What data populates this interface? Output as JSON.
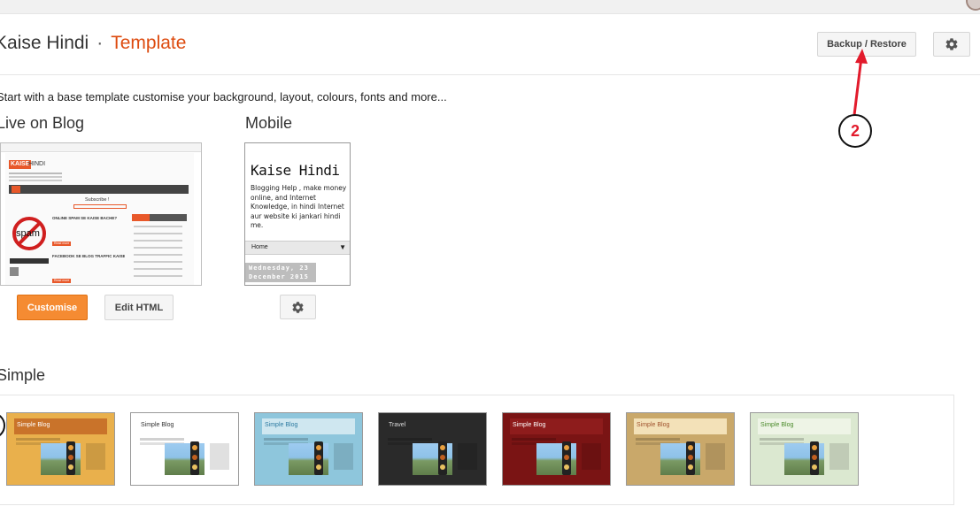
{
  "header": {
    "blog_name": "Kaise Hindi",
    "separator": "·",
    "section": "Template",
    "backup_restore_label": "Backup / Restore"
  },
  "intro_text": "Start with a base template customise your background, layout, colours, fonts and more...",
  "live": {
    "heading": "Live on Blog",
    "customise_label": "Customise",
    "edit_html_label": "Edit HTML",
    "preview": {
      "logo_badge": "KAISE",
      "logo_text": "HINDI",
      "subscribe": "Subscribe !",
      "spam": "spam",
      "post_title_1": "ONLINE SPAM SE KAISE BACHE?",
      "post_title_2": "FACEBOOK SE BLOG TRAFFIC KAISE PAAYE ...",
      "read_more": "Read more"
    }
  },
  "mobile": {
    "heading": "Mobile",
    "title": "Kaise Hindi",
    "description": "Blogging Help , make money online, and Internet Knowledge, in hindi Internet aur website ki jankari hindi me.",
    "home_label": "Home",
    "date_label": "Wednesday, 23 December 2015"
  },
  "simple": {
    "heading": "Simple",
    "themes": [
      {
        "label": "Simple Blog",
        "bg": "#e9b04c",
        "bar": "#c9732a",
        "panel": "#fff7e6",
        "text": "#ffffff"
      },
      {
        "label": "Simple Blog",
        "bg": "#ffffff",
        "bar": "#ffffff",
        "panel": "#ffffff",
        "text": "#333333"
      },
      {
        "label": "Simple Blog",
        "bg": "#8ec6dc",
        "bar": "#cfe7f0",
        "panel": "#ffffff",
        "text": "#2c7aa0"
      },
      {
        "label": "Travel",
        "bg": "#2a2a2a",
        "bar": "#2a2a2a",
        "panel": "#3a3a3a",
        "text": "#dddddd"
      },
      {
        "label": "Simple Blog",
        "bg": "#7a1414",
        "bar": "#8e1c1c",
        "panel": "#a42a2a",
        "text": "#ffffff"
      },
      {
        "label": "Simple Blog",
        "bg": "#c9a86a",
        "bar": "#f3e1b8",
        "panel": "#fff7e0",
        "text": "#a0522d"
      },
      {
        "label": "Simple Blog",
        "bg": "#dbe8d0",
        "bar": "#eef4e6",
        "panel": "#f8fbf4",
        "text": "#4a8a2a"
      }
    ]
  },
  "annotation": {
    "callout_number": "2",
    "color": "#e21b2c"
  },
  "icons": {
    "settings": "gear-icon",
    "mobile_settings": "gear-icon"
  }
}
